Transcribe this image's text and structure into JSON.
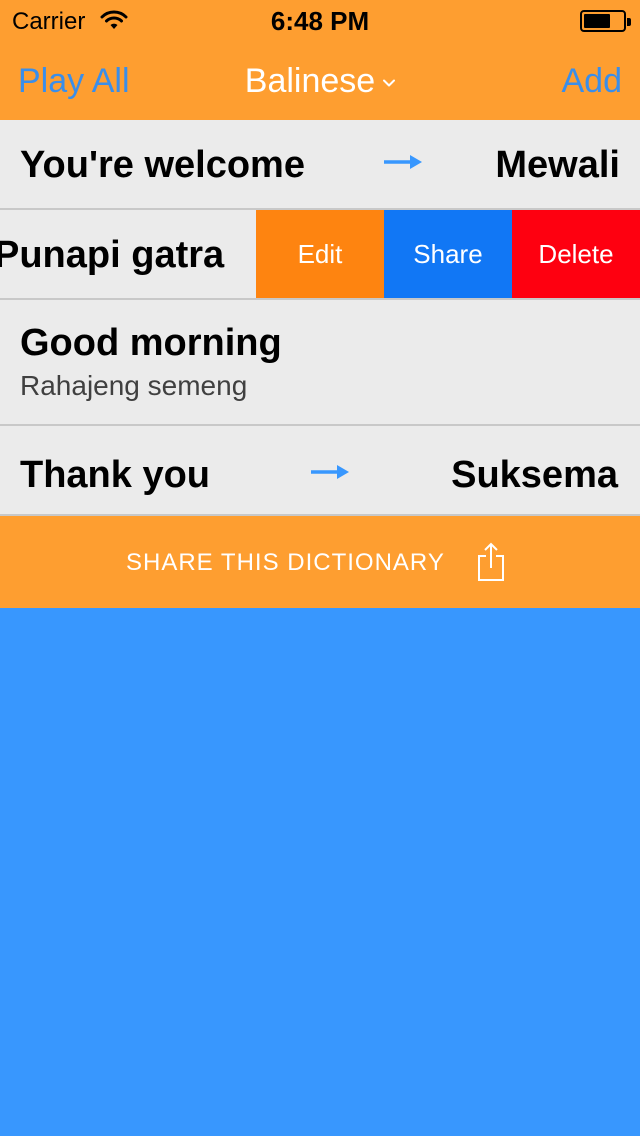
{
  "status_bar": {
    "carrier": "Carrier",
    "time": "6:48 PM"
  },
  "nav": {
    "left_label": "Play All",
    "title": "Balinese",
    "right_label": "Add"
  },
  "rows": [
    {
      "phrase": "You're welcome",
      "translation": "Mewali"
    },
    {
      "phrase": "Punapi gatra"
    },
    {
      "phrase": "Good morning",
      "translation": "Rahajeng semeng"
    },
    {
      "phrase": "Thank you",
      "translation": "Suksema"
    }
  ],
  "row_actions": {
    "edit": "Edit",
    "share": "Share",
    "delete": "Delete"
  },
  "share_bar": {
    "label": "SHARE THIS DICTIONARY"
  },
  "colors": {
    "accent_orange": "#FE9E30",
    "background_blue": "#3897FE",
    "link_blue": "#3A8EEA",
    "edit_orange": "#FE8410",
    "share_blue": "#1177F5",
    "delete_red": "#FE0010"
  },
  "icons": [
    "wifi-icon",
    "battery-icon",
    "chevron-down-icon",
    "arrow-right-icon",
    "share-icon"
  ]
}
